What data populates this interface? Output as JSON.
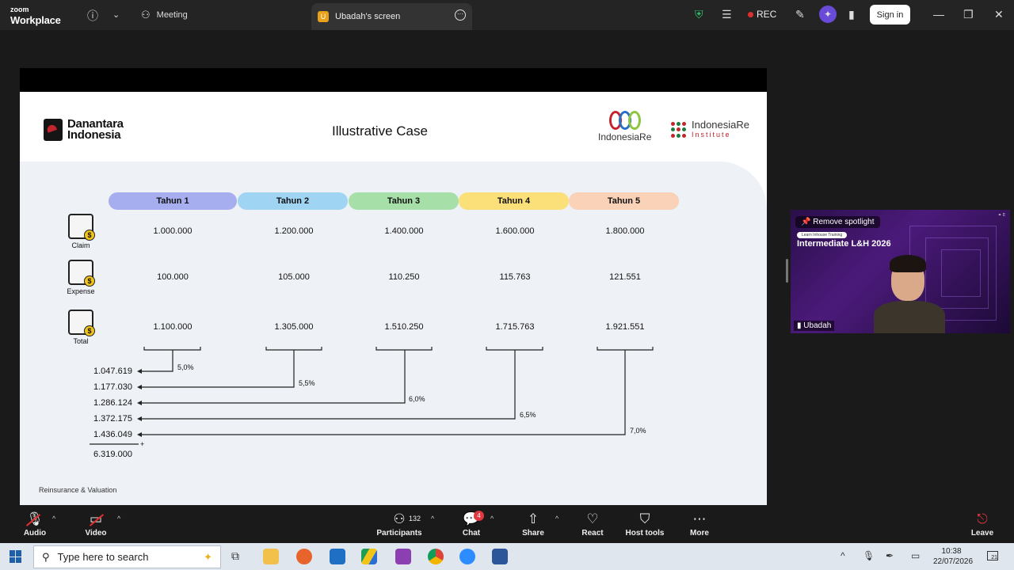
{
  "titlebar": {
    "logo_top": "zoom",
    "logo_bottom": "Workplace",
    "meeting_label": "Meeting",
    "screen_tab_label": "Ubadah's screen",
    "screen_tab_initial": "U",
    "rec_label": "REC",
    "signin_label": "Sign in"
  },
  "slide": {
    "title": "Illustrative Case",
    "brand_left": "Danantara Indonesia",
    "brand_ire": "IndonesiaRe",
    "brand_iri": "IndonesiaRe",
    "brand_iri_sub": "Institute",
    "years": [
      "Tahun 1",
      "Tahun 2",
      "Tahun 3",
      "Tahun 4",
      "Tahun 5"
    ],
    "year_colors": [
      "#a6aef0",
      "#9fd4f3",
      "#a6dfa8",
      "#fbe07a",
      "#f9d2b8"
    ],
    "row_labels": [
      "Claim",
      "Expense",
      "Total"
    ],
    "claim": [
      "1.000.000",
      "1.200.000",
      "1.400.000",
      "1.600.000",
      "1.800.000"
    ],
    "expense": [
      "100.000",
      "105.000",
      "110.250",
      "115.763",
      "121.551"
    ],
    "total": [
      "1.100.000",
      "1.305.000",
      "1.510.250",
      "1.715.763",
      "1.921.551"
    ],
    "pv_values": [
      "1.047.619",
      "1.177.030",
      "1.286.124",
      "1.372.175",
      "1.436.049"
    ],
    "rates": [
      "5,0%",
      "5,5%",
      "6,0%",
      "6,5%",
      "7,0%"
    ],
    "sum_sign": "+",
    "sum_total": "6.319.000",
    "footer": "Reinsurance & Valuation"
  },
  "video": {
    "spotlight_label": "Remove spotlight",
    "badge": "Learn Inhouse Training",
    "title": "Intermediate L&H 2026",
    "participant_name": "Ubadah"
  },
  "toolbar": {
    "audio": "Audio",
    "video": "Video",
    "participants": "Participants",
    "participants_count": "132",
    "chat": "Chat",
    "chat_badge": "4",
    "share": "Share",
    "react": "React",
    "host_tools": "Host tools",
    "more": "More",
    "leave": "Leave"
  },
  "taskbar": {
    "search_placeholder": "Type here to search",
    "time": "10:38",
    "date": "22/07/2026",
    "notif_count": "21"
  }
}
